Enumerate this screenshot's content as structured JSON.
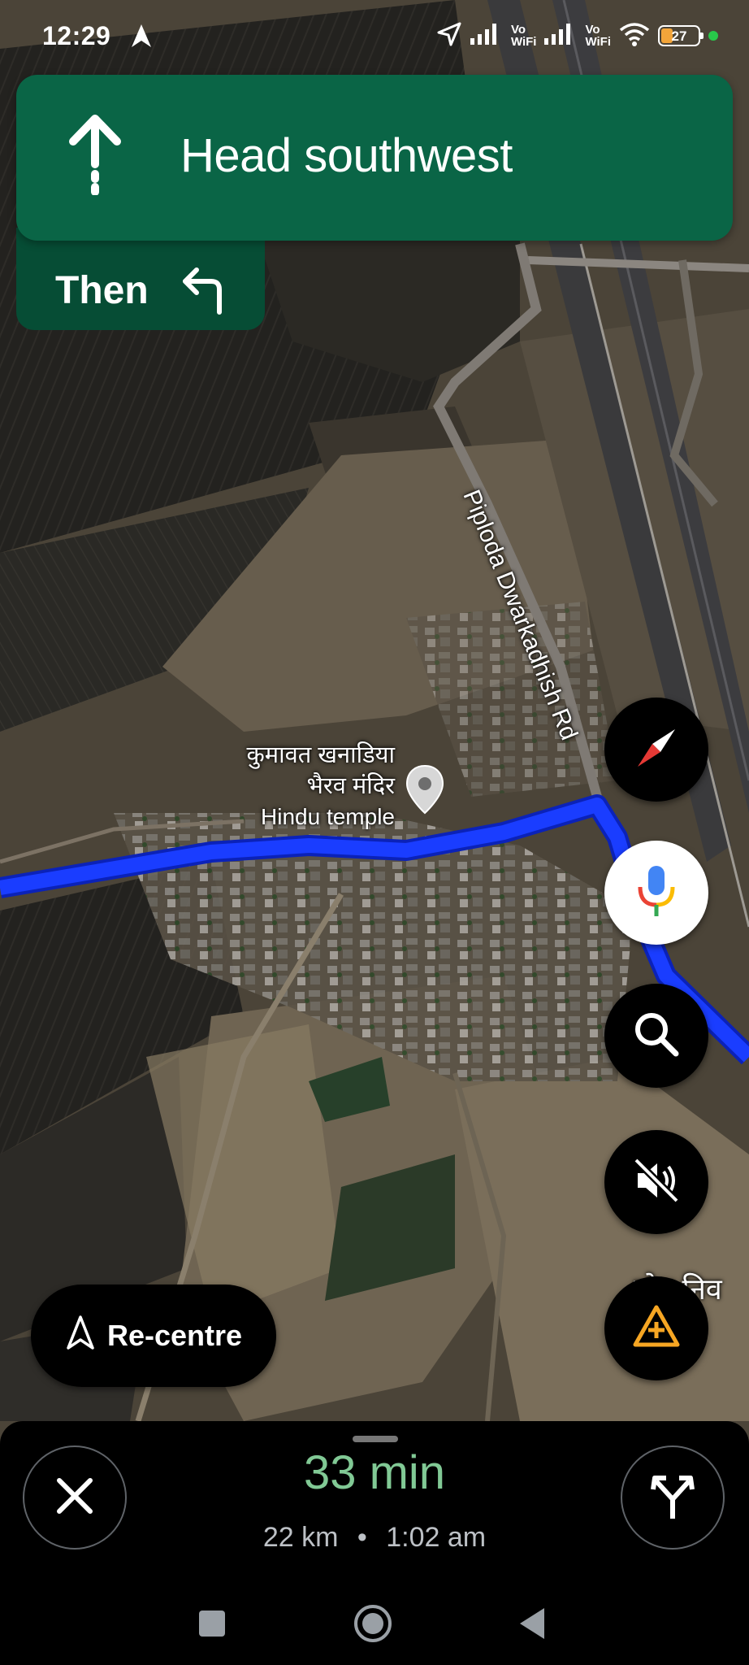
{
  "status_bar": {
    "time": "12:29",
    "signal1_label_top": "Vo",
    "signal1_label_bottom": "WiFi",
    "signal2_label_top": "Vo",
    "signal2_label_bottom": "WiFi",
    "battery_level": "27",
    "icons": [
      "navigation-arrow-icon",
      "location-arrow-icon",
      "signal-icon",
      "wifi-icon",
      "battery-icon"
    ]
  },
  "navigation": {
    "instruction": "Head southwest",
    "next_label": "Then",
    "colors": {
      "primary": "#0a6546",
      "secondary": "#064d35"
    }
  },
  "map": {
    "poi_name_line1": "कुमावत खनाडिया",
    "poi_name_line2": "भैरव मंदिर",
    "poi_type": "Hindu temple",
    "road_label": "Piploda Dwarkadhish Rd",
    "partial_label": "ठोड निव",
    "route_color": "#1a3dff"
  },
  "controls": {
    "recentre_label": "Re-centre",
    "icons": [
      "compass-icon",
      "microphone-icon",
      "search-icon",
      "mute-icon",
      "report-incident-icon"
    ]
  },
  "trip": {
    "eta_duration": "33 min",
    "distance": "22 km",
    "separator": "•",
    "arrival_time": "1:02 am"
  }
}
